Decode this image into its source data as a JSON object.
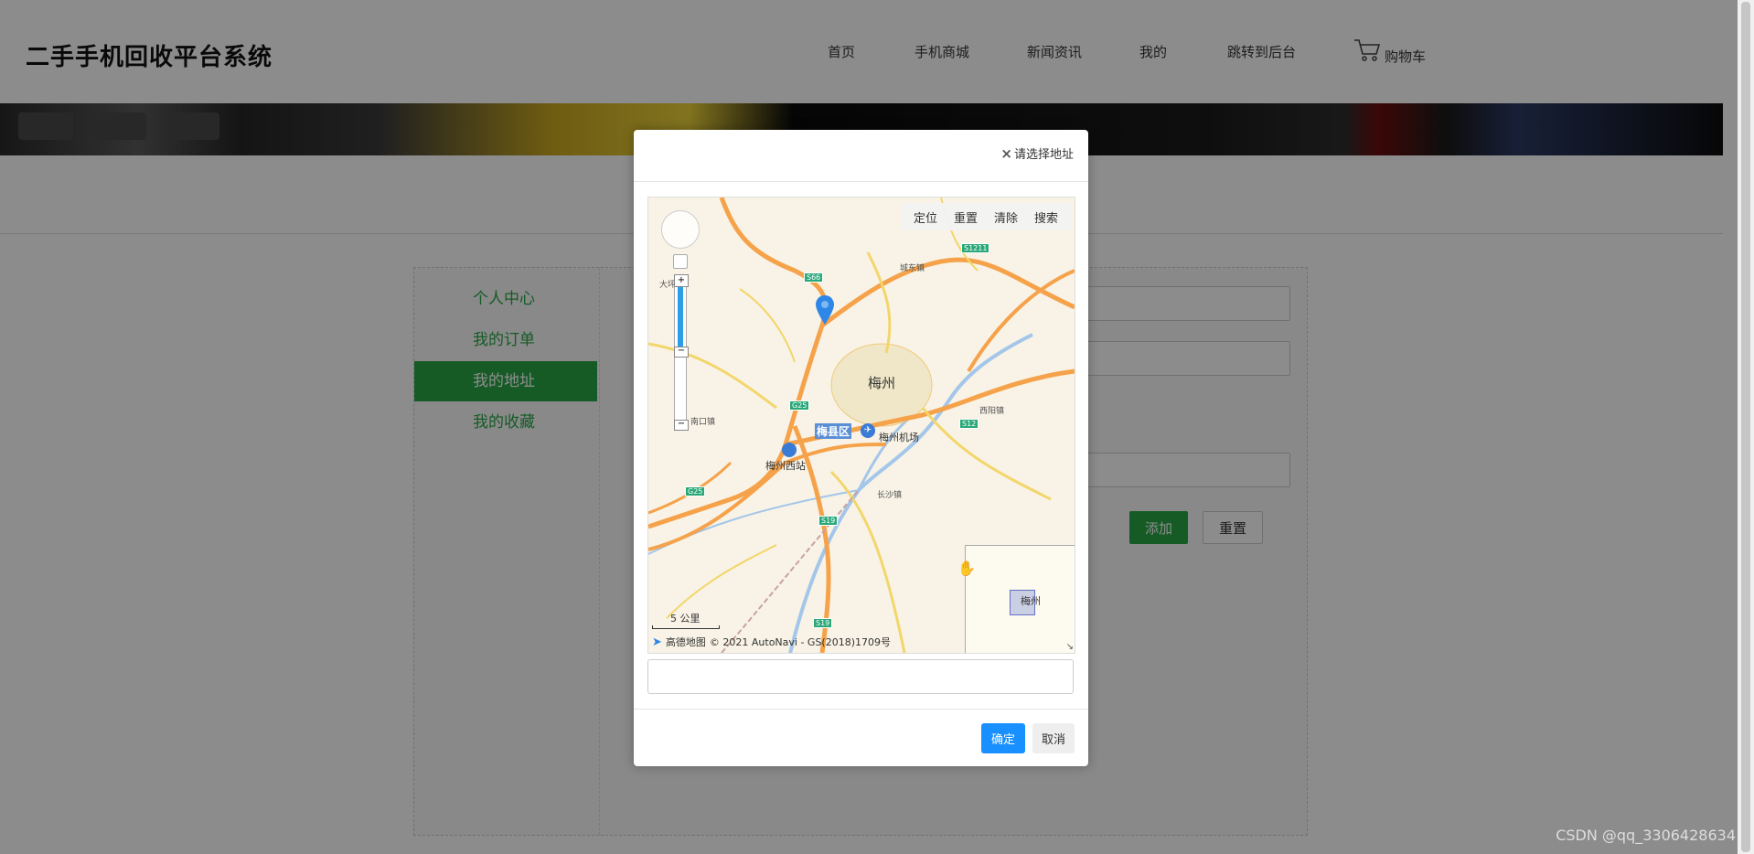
{
  "header": {
    "logo": "二手手机回收平台系统",
    "nav": [
      {
        "label": "首页",
        "key": "home"
      },
      {
        "label": "手机商城",
        "key": "shop"
      },
      {
        "label": "新闻资讯",
        "key": "news"
      },
      {
        "label": "我的",
        "key": "mine"
      },
      {
        "label": "跳转到后台",
        "key": "admin"
      }
    ],
    "cart_label": "购物车"
  },
  "sidebar": {
    "items": [
      {
        "label": "个人中心",
        "active": false
      },
      {
        "label": "我的订单",
        "active": false
      },
      {
        "label": "我的地址",
        "active": true
      },
      {
        "label": "我的收藏",
        "active": false
      }
    ]
  },
  "form": {
    "add_label": "添加",
    "reset_label": "重置"
  },
  "dialog": {
    "title": "请选择地址",
    "map": {
      "tools": [
        "定位",
        "重置",
        "清除",
        "搜索"
      ],
      "city_label": "梅州",
      "district_label": "梅县区",
      "airport_label": "梅州机场",
      "station_label": "梅州西站",
      "towns": [
        "城东镇",
        "南口镇",
        "西阳镇",
        "长沙镇",
        "大坪镇"
      ],
      "roads": [
        "S66",
        "S1211",
        "G25",
        "S12",
        "G25",
        "S19",
        "S19"
      ],
      "scale_label": "5 公里",
      "brand_label": "高德地图",
      "copyright": "© 2021 AutoNavi - GS(2018)1709号",
      "overview_label": "梅州"
    },
    "address_value": "",
    "ok_label": "确定",
    "cancel_label": "取消"
  },
  "watermark": "CSDN @qq_3306428634"
}
